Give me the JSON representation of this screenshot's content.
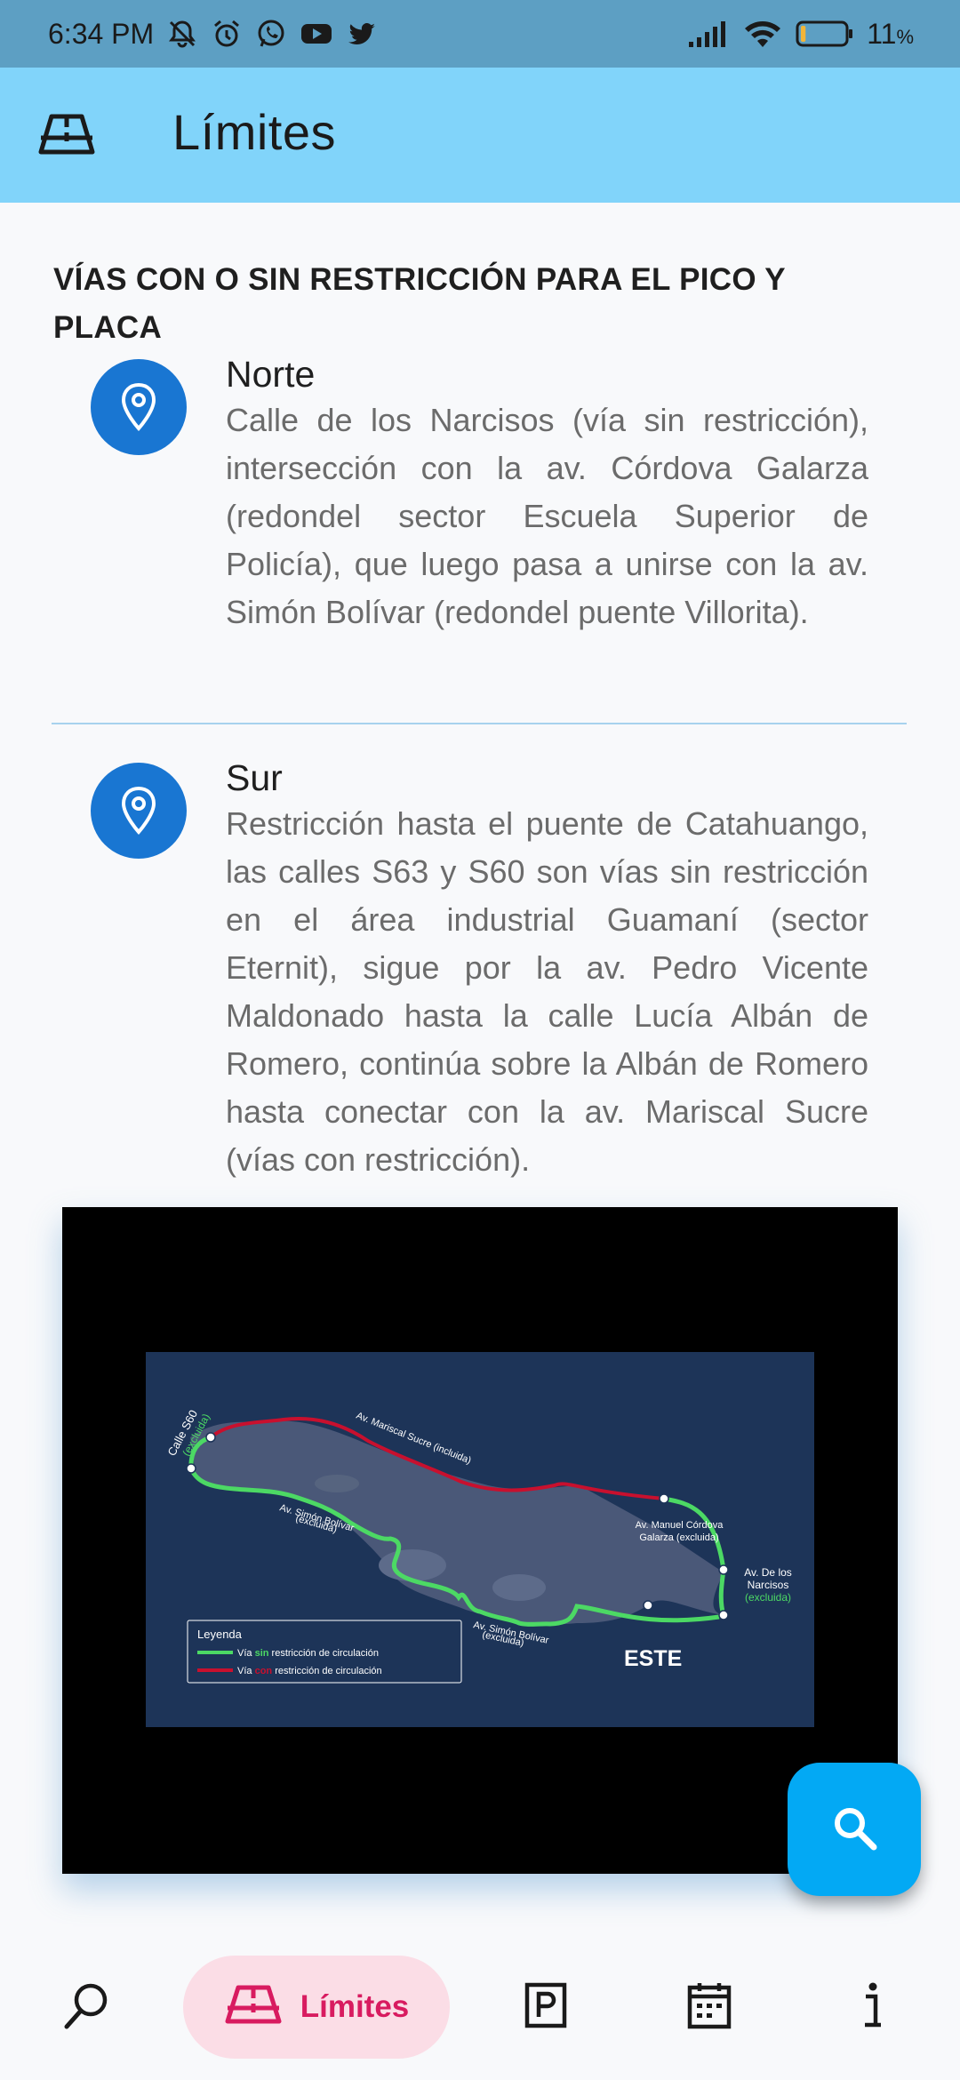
{
  "status_bar": {
    "time": "6:34 PM",
    "battery": "11",
    "battery_unit": "%",
    "battery_level": 0.11,
    "icons_left": [
      "mute-icon",
      "alarm-icon",
      "whatsapp-icon",
      "youtube-icon",
      "twitter-icon"
    ],
    "icons_right": [
      "signal-icon",
      "wifi-icon",
      "battery-icon"
    ]
  },
  "app_bar": {
    "title": "Límites",
    "icon": "road-icon"
  },
  "main": {
    "heading": "VÍAS CON O SIN RESTRICCIÓN PARA EL PICO Y PLACA",
    "items": [
      {
        "title": "Norte",
        "description": "Calle de los Narcisos (vía sin restricción), intersección con la av. Córdova Galarza (redondel sector Escuela Superior de Policía), que luego pasa a unirse con la av. Simón Bolívar (redondel puente Villorita).",
        "icon": "location-pin-icon"
      },
      {
        "title": "Sur",
        "description": "Restricción hasta el puente de Catahuango, las calles S63 y S60 son vías sin restricción en el área industrial Guamaní (sector Eternit), sigue por la av. Pedro Vicente Maldonado hasta la calle Lucía Albán de Romero, continúa sobre la Albán de Romero hasta conectar con la av. Mariscal Sucre (vías con restricción).",
        "icon": "location-pin-icon"
      }
    ]
  },
  "map": {
    "zone_label": "ESTE",
    "labels": {
      "calle_s60": "Calle S60",
      "calle_s60_note": "(excluida)",
      "mariscal_sucre": "Av. Mariscal Sucre (incluida)",
      "simon_bolivar_1": "Av. Simón Bolívar",
      "simon_bolivar_1_note": "(excluida)",
      "simon_bolivar_2": "Av. Simón Bolívar",
      "simon_bolivar_2_note": "(excluida)",
      "cordova_galarza_1": "Av. Manuel Córdova",
      "cordova_galarza_2": "Galarza (excluida)",
      "narcisos_1": "Av. De los",
      "narcisos_2": "Narcisos",
      "narcisos_note": "(excluida)"
    },
    "legend": {
      "title": "Leyenda",
      "row1_prefix": "Vía ",
      "row1_highlight": "sin",
      "row1_suffix": " restricción de circulación",
      "row2_prefix": "Vía ",
      "row2_highlight": "con",
      "row2_suffix": " restricción de circulación"
    },
    "colors": {
      "background": "#1d3458",
      "zone_fill": "#4a5878",
      "unrestricted": "#4cd964",
      "restricted": "#c8102e",
      "text": "#ffffff"
    }
  },
  "fab": {
    "icon": "search-icon"
  },
  "bottom_nav": {
    "items": [
      {
        "icon": "search-icon"
      },
      {
        "icon": "road-icon",
        "label": "Límites",
        "active": true
      },
      {
        "icon": "parking-icon"
      },
      {
        "icon": "calendar-icon"
      },
      {
        "icon": "info-icon"
      }
    ]
  }
}
